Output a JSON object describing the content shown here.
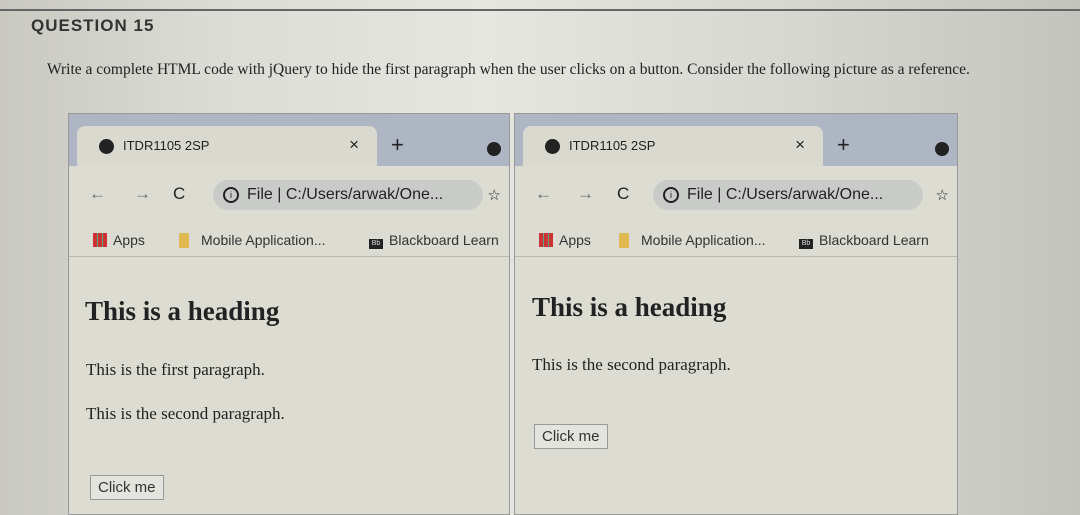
{
  "question": {
    "title": "QUESTION 15",
    "text": "Write a complete HTML code with jQuery to hide the first paragraph when the user clicks on a button. Consider the following picture as a reference."
  },
  "browsers": [
    {
      "tab_title": "ITDR1105 2SP",
      "close": "×",
      "plus": "+",
      "url": "File | C:/Users/arwak/One...",
      "bookmarks": [
        "Apps",
        "Mobile Application...",
        "Blackboard Learn"
      ],
      "heading": "This is a heading",
      "paragraphs": [
        "This is the first paragraph.",
        "This is the second paragraph."
      ],
      "button": "Click me"
    },
    {
      "tab_title": "ITDR1105 2SP",
      "close": "×",
      "plus": "+",
      "url": "File | C:/Users/arwak/One...",
      "bookmarks": [
        "Apps",
        "Mobile Application...",
        "Blackboard Learn"
      ],
      "heading": "This is a heading",
      "paragraphs": [
        "This is the second paragraph."
      ],
      "button": "Click me"
    }
  ]
}
